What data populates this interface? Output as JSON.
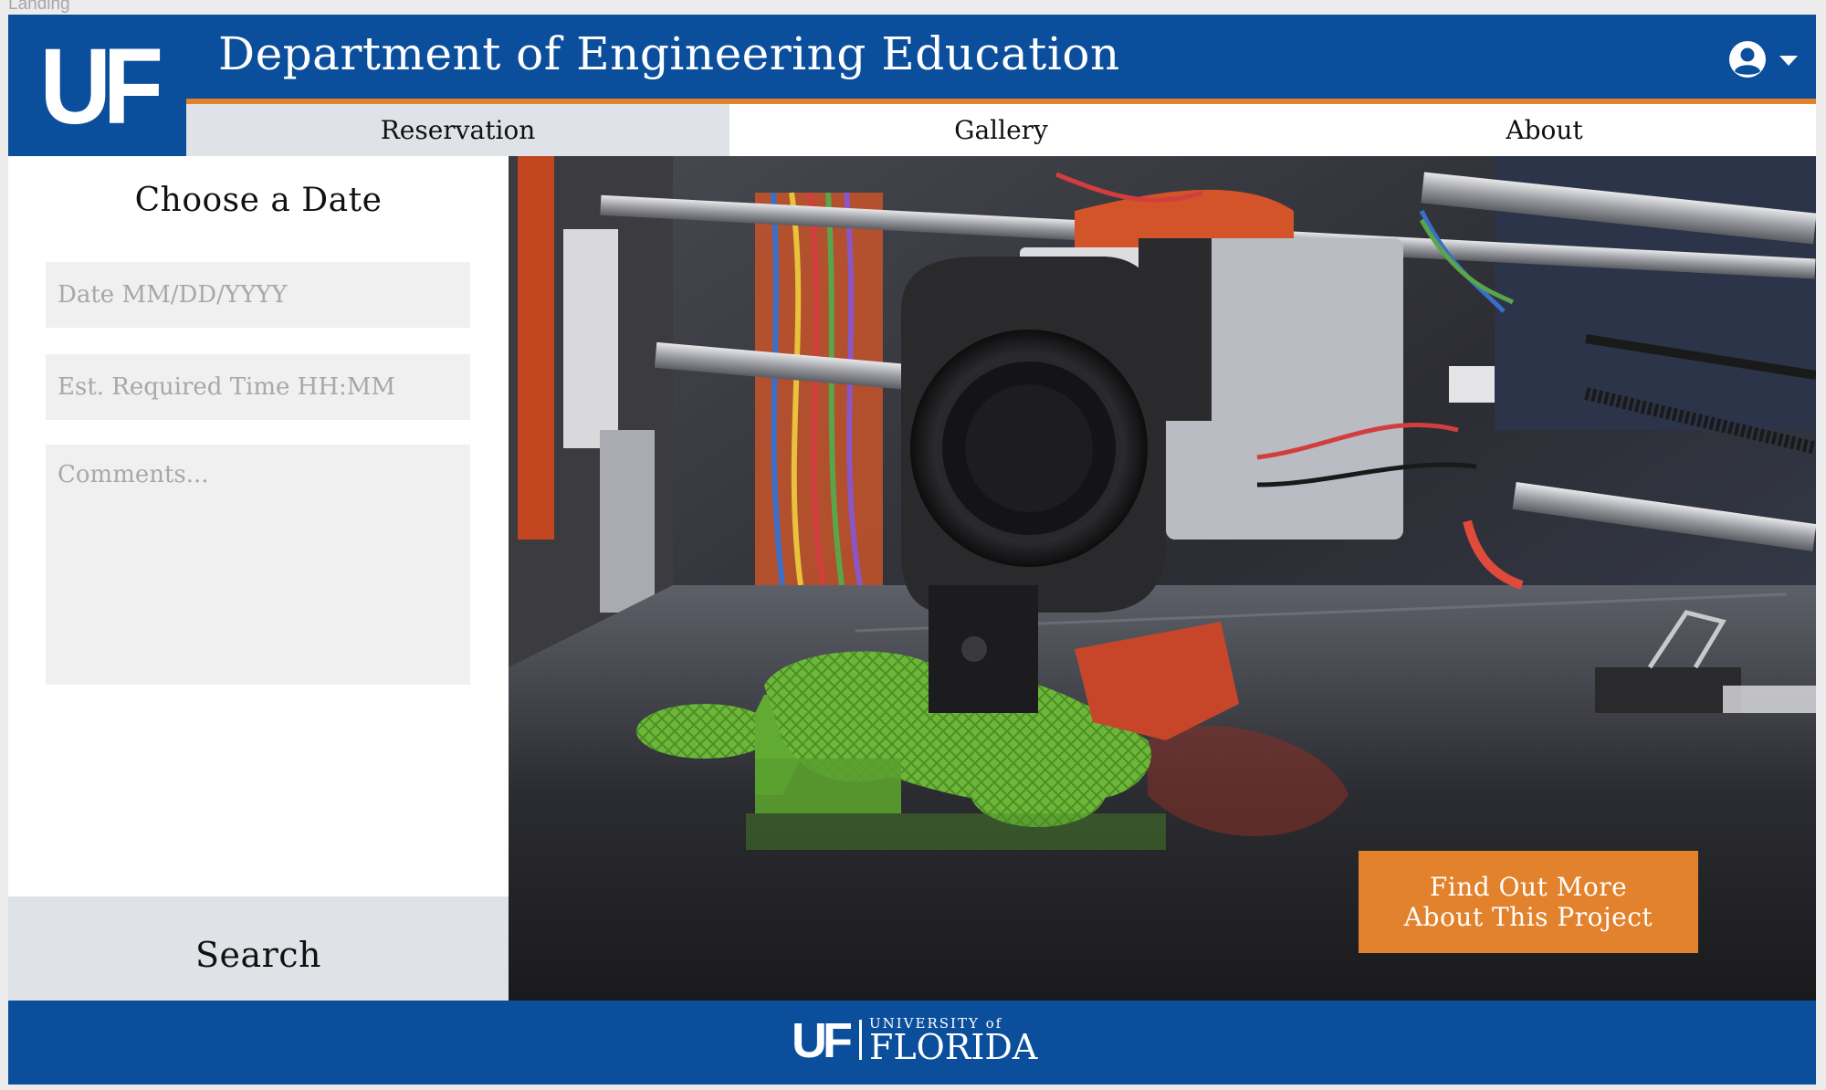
{
  "frame": {
    "label": "Landing"
  },
  "header": {
    "logo_text": "UF",
    "title": "Department of Engineering Education",
    "user_icon": "user-circle-icon",
    "menu_icon": "caret-down-icon"
  },
  "nav": {
    "tabs": [
      {
        "label": "Reservation",
        "active": true
      },
      {
        "label": "Gallery",
        "active": false
      },
      {
        "label": "About",
        "active": false
      }
    ]
  },
  "sidebar": {
    "title": "Choose a Date",
    "date_placeholder": "Date MM/DD/YYYY",
    "date_value": "",
    "time_placeholder": "Est. Required Time HH:MM",
    "time_value": "",
    "comments_placeholder": "Comments...",
    "comments_value": "",
    "search_label": "Search"
  },
  "hero": {
    "image": "3d-printer-photo",
    "cta_line1": "Find Out More",
    "cta_line2": "About This Project"
  },
  "footer": {
    "logo_uf": "UF",
    "logo_small": "UNIVERSITY of",
    "logo_big": "FLORIDA"
  },
  "colors": {
    "brand_blue": "#0b4f9c",
    "brand_orange": "#e2822c",
    "tab_active": "#dfe2e7",
    "input_bg": "#f0f0f1"
  }
}
